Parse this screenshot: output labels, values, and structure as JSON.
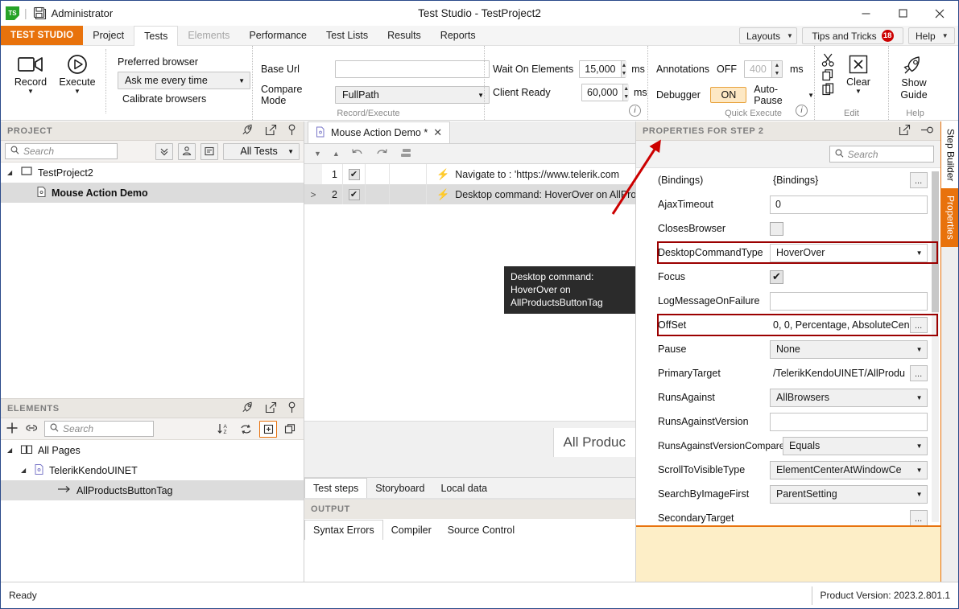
{
  "titlebar": {
    "app_icon": "test-studio-logo",
    "save_icon": "save-icon",
    "user": "Administrator",
    "title": "Test Studio - TestProject2",
    "minimize": "─",
    "maximize": "☐",
    "close": "✕"
  },
  "ribbon_tabs": {
    "brand": "TEST STUDIO",
    "items": [
      {
        "label": "Project",
        "state": "normal"
      },
      {
        "label": "Tests",
        "state": "active"
      },
      {
        "label": "Elements",
        "state": "disabled"
      },
      {
        "label": "Performance",
        "state": "normal"
      },
      {
        "label": "Test Lists",
        "state": "normal"
      },
      {
        "label": "Results",
        "state": "normal"
      },
      {
        "label": "Reports",
        "state": "normal"
      }
    ],
    "layouts": "Layouts",
    "tips": "Tips and Tricks",
    "tips_badge": "18",
    "help": "Help"
  },
  "ribbon": {
    "record": "Record",
    "execute": "Execute",
    "preferred_browser_label": "Preferred browser",
    "preferred_browser_value": "Ask me every time",
    "calibrate": "Calibrate browsers",
    "base_url_label": "Base Url",
    "base_url_value": "",
    "compare_mode_label": "Compare Mode",
    "compare_mode_value": "FullPath",
    "group_record_execute": "Record/Execute",
    "wait_on_elements_label": "Wait On Elements",
    "wait_on_elements_value": "15,000",
    "wait_on_elements_unit": "ms",
    "client_ready_label": "Client Ready",
    "client_ready_value": "60,000",
    "client_ready_unit": "ms",
    "annotations_label": "Annotations",
    "annotations_state": "OFF",
    "annotations_value": "400",
    "annotations_unit": "ms",
    "debugger_label": "Debugger",
    "debugger_state": "ON",
    "auto_pause": "Auto-Pause",
    "group_quick_execute": "Quick Execute",
    "clear": "Clear",
    "group_edit": "Edit",
    "show_guide_line1": "Show",
    "show_guide_line2": "Guide",
    "group_help": "Help"
  },
  "project_pane": {
    "title": "PROJECT",
    "search_placeholder": "Search",
    "filter": "All Tests",
    "tree": [
      {
        "label": "TestProject2",
        "level": 0,
        "selected": false,
        "bold": false,
        "icon": "project-icon"
      },
      {
        "label": "Mouse Action Demo",
        "level": 1,
        "selected": true,
        "bold": true,
        "icon": "test-file-icon"
      }
    ]
  },
  "elements_pane": {
    "title": "ELEMENTS",
    "search_placeholder": "Search",
    "tree": [
      {
        "label": "All Pages",
        "level": 0,
        "selected": false,
        "icon": "pages-icon"
      },
      {
        "label": "TelerikKendoUINET",
        "level": 1,
        "selected": false,
        "icon": "page-icon"
      },
      {
        "label": "AllProductsButtonTag",
        "level": 2,
        "selected": true,
        "icon": "element-arrow-icon"
      }
    ]
  },
  "center": {
    "doc_tab": "Mouse Action Demo *",
    "steps": [
      {
        "num": "1",
        "checked": true,
        "selected": false,
        "text": "Navigate to : 'https://www.telerik.com"
      },
      {
        "num": "2",
        "checked": true,
        "selected": true,
        "text": "Desktop command: HoverOver on AllProd"
      }
    ],
    "tooltip": "Desktop command: HoverOver on AllProductsButtonTag",
    "preview_text": "All Produc",
    "bottom_tabs": [
      {
        "label": "Test steps",
        "active": true
      },
      {
        "label": "Storyboard",
        "active": false
      },
      {
        "label": "Local data",
        "active": false
      }
    ],
    "output_title": "OUTPUT",
    "output_tabs": [
      {
        "label": "Syntax Errors",
        "active": true
      },
      {
        "label": "Compiler",
        "active": false
      },
      {
        "label": "Source Control",
        "active": false
      }
    ]
  },
  "properties": {
    "title": "PROPERTIES FOR STEP 2",
    "search_placeholder": "Search",
    "rows": [
      {
        "name": "(Bindings)",
        "kind": "text-ellipsis",
        "value": "{Bindings}",
        "highlight": false
      },
      {
        "name": "AjaxTimeout",
        "kind": "input",
        "value": "0",
        "highlight": false
      },
      {
        "name": "ClosesBrowser",
        "kind": "checkbox",
        "value": "",
        "checked": false,
        "highlight": false
      },
      {
        "name": "DesktopCommandType",
        "kind": "combo",
        "value": "HoverOver",
        "highlight": true
      },
      {
        "name": "Focus",
        "kind": "checkbox",
        "value": "✔",
        "checked": true,
        "highlight": false
      },
      {
        "name": "LogMessageOnFailure",
        "kind": "input",
        "value": "",
        "highlight": false
      },
      {
        "name": "OffSet",
        "kind": "text-ellipsis",
        "value": "0, 0, Percentage, AbsoluteCen",
        "highlight": true
      },
      {
        "name": "Pause",
        "kind": "combo",
        "value": "None",
        "highlight": false
      },
      {
        "name": "PrimaryTarget",
        "kind": "text-ellipsis",
        "value": "/TelerikKendoUINET/AllProdu",
        "highlight": false
      },
      {
        "name": "RunsAgainst",
        "kind": "combo",
        "value": "AllBrowsers",
        "highlight": false
      },
      {
        "name": "RunsAgainstVersion",
        "kind": "input",
        "value": "",
        "highlight": false
      },
      {
        "name": "RunsAgainstVersionCompare",
        "kind": "combo",
        "value": "Equals",
        "highlight": false
      },
      {
        "name": "ScrollToVisibleType",
        "kind": "combo",
        "value": "ElementCenterAtWindowCe",
        "highlight": false
      },
      {
        "name": "SearchByImageFirst",
        "kind": "combo",
        "value": "ParentSetting",
        "highlight": false
      },
      {
        "name": "SecondaryTarget",
        "kind": "ellipsis-only",
        "value": "",
        "highlight": false
      }
    ]
  },
  "side_tabs": [
    {
      "label": "Step Builder",
      "active": false
    },
    {
      "label": "Properties",
      "active": true
    }
  ],
  "statusbar": {
    "status": "Ready",
    "product_version": "Product Version: 2023.2.801.1"
  },
  "colors": {
    "brand_orange": "#e8720c",
    "highlight_red": "#9b0000",
    "badge_red": "#cc0000",
    "accent_yellow": "#fdeec7"
  }
}
